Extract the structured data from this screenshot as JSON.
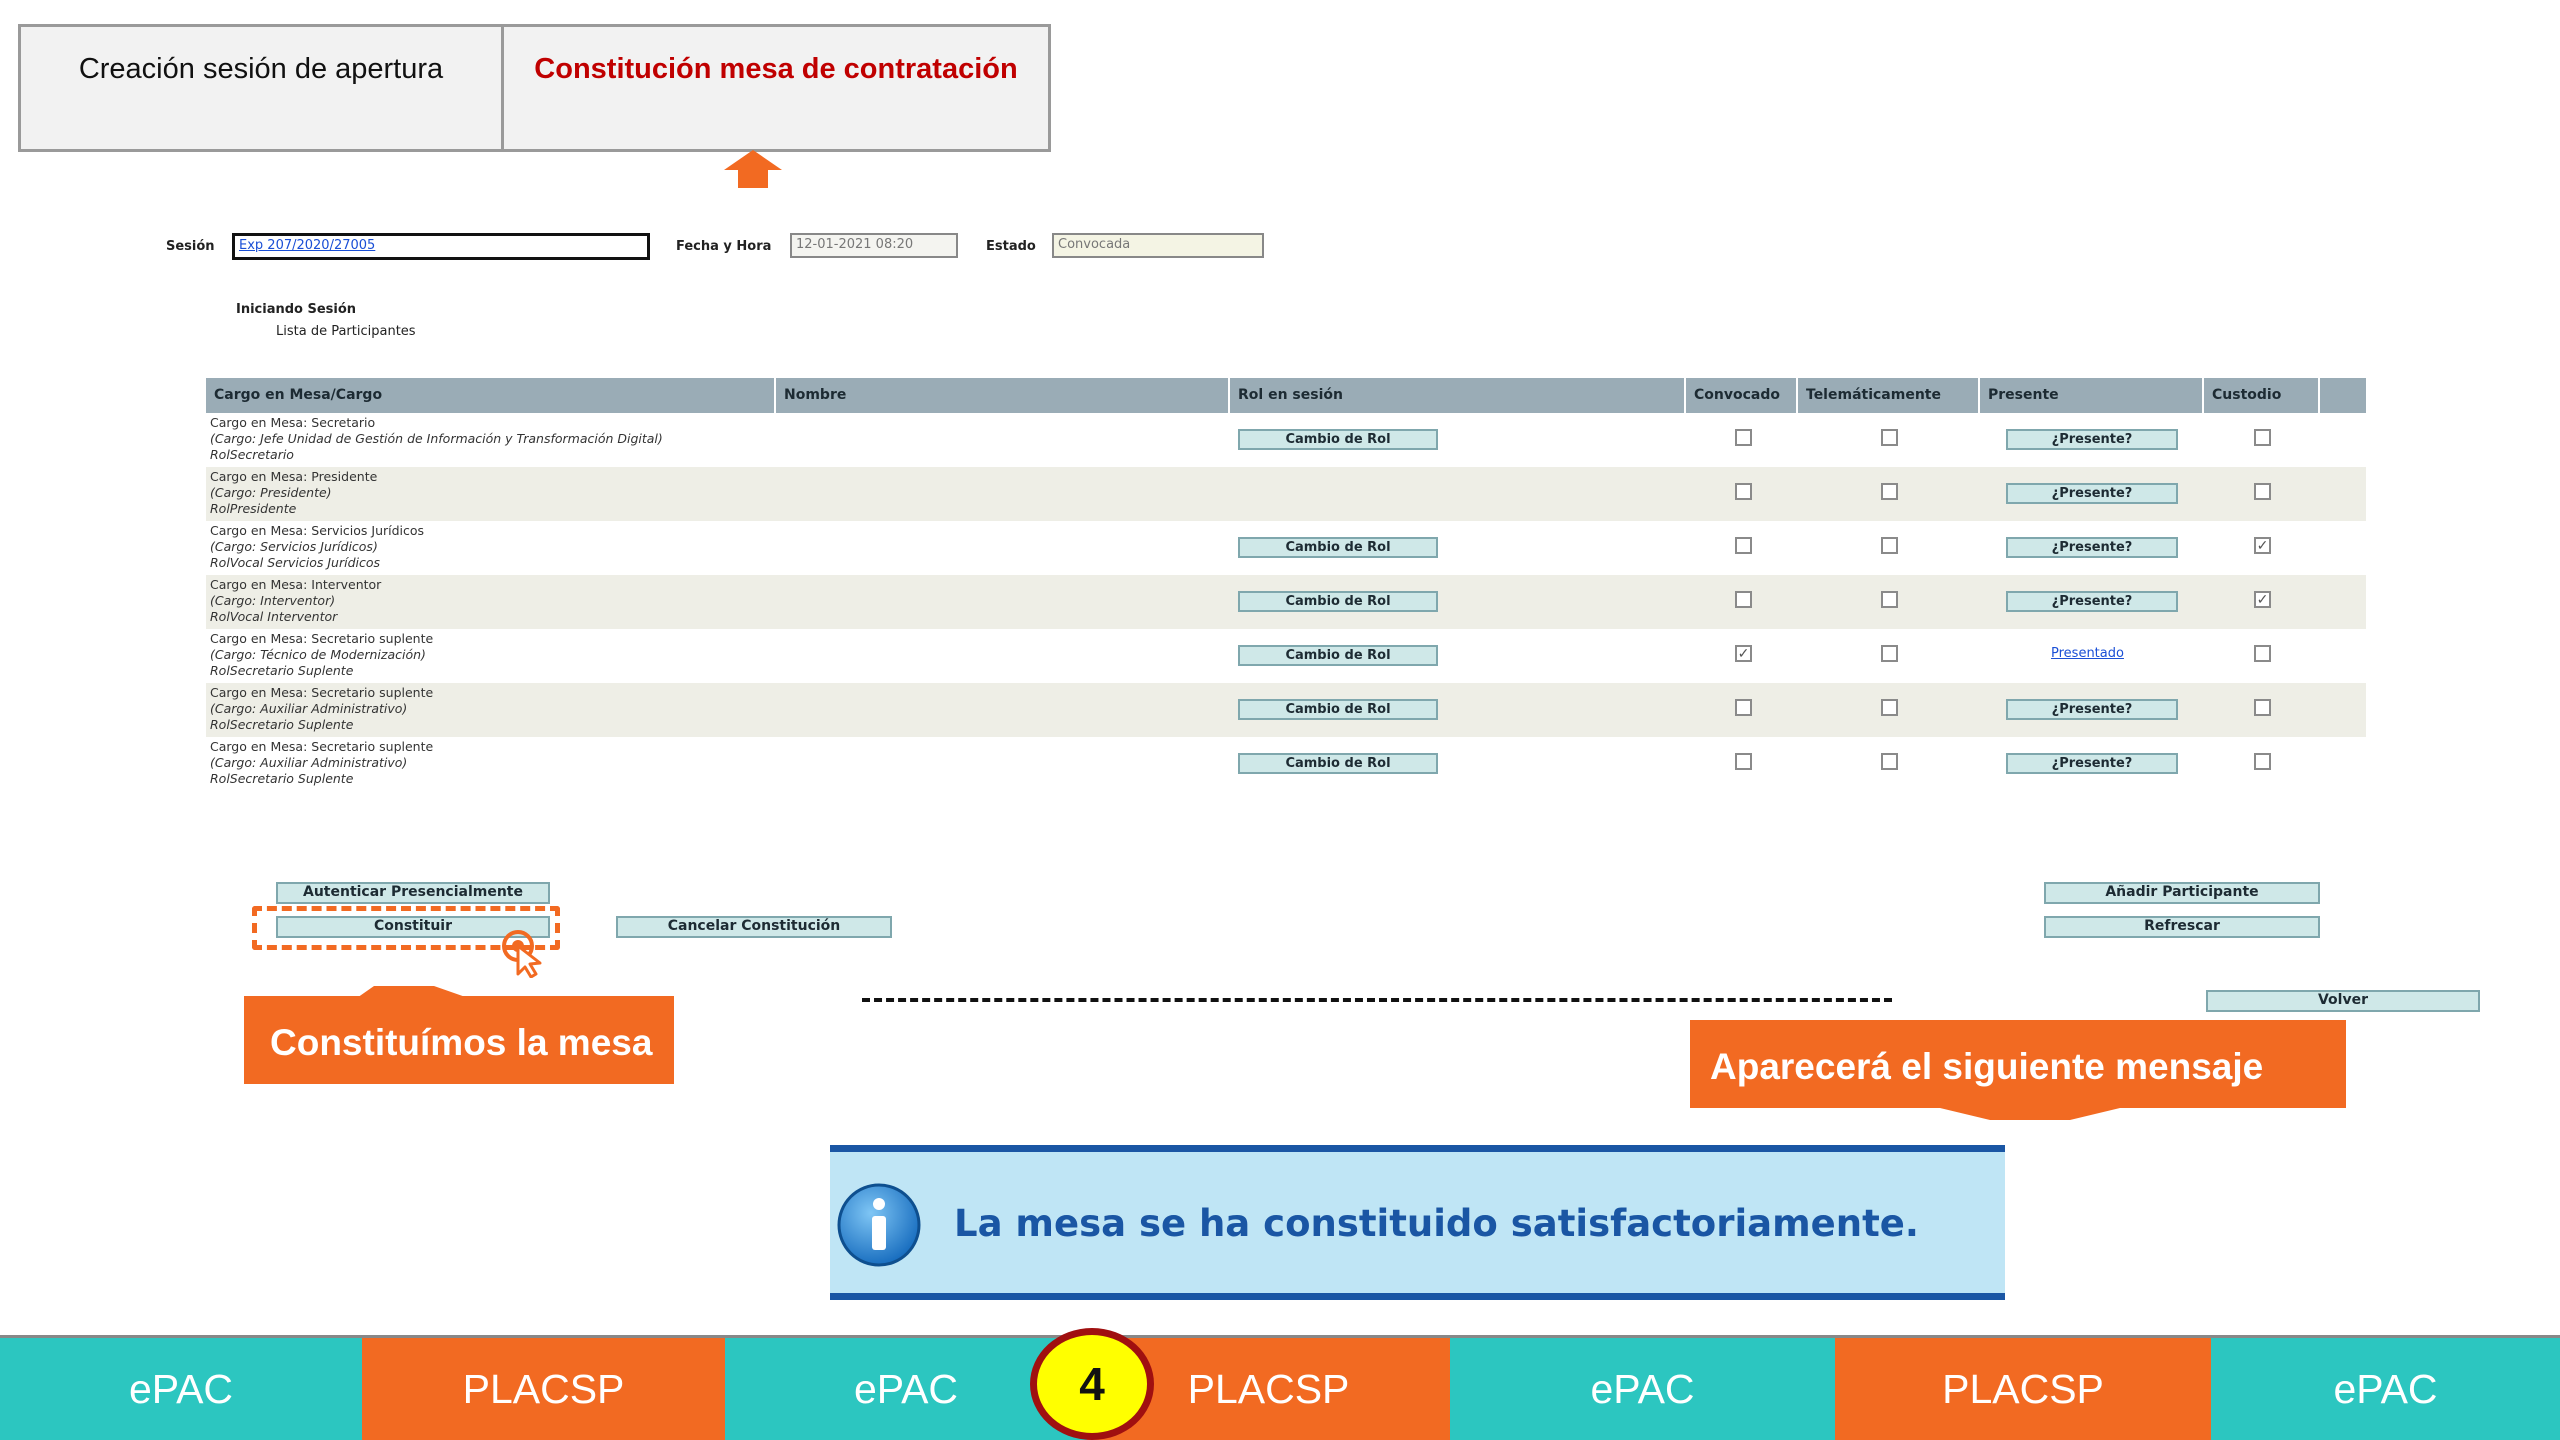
{
  "top_tabs": [
    {
      "label": "Creación sesión de apertura",
      "active": false
    },
    {
      "label": "Constitución mesa de contratación",
      "active": true
    }
  ],
  "form": {
    "session_label": "Sesión",
    "session_value": "Exp 207/2020/27005",
    "date_label": "Fecha y Hora",
    "date_value": "12-01-2021 08:20",
    "status_label": "Estado",
    "status_value": "Convocada"
  },
  "section": {
    "title": "Iniciando Sesión",
    "subtitle": "Lista de Participantes"
  },
  "table": {
    "headers": [
      "Cargo en Mesa/Cargo",
      "Nombre",
      "Rol en sesión",
      "Convocado",
      "Telemáticamente",
      "Presente",
      "Custodio"
    ],
    "rows": [
      {
        "line1": "Cargo en Mesa: Secretario",
        "line2": "(Cargo: Jefe Unidad de Gestión de Información y Transformación Digital)",
        "line3": "RolSecretario",
        "rol_button": "Cambio de Rol",
        "convocado": false,
        "telematicamente": false,
        "presente": "¿Presente?",
        "presente_is_link": false,
        "custodio": false
      },
      {
        "line1": "Cargo en Mesa: Presidente",
        "line2": "(Cargo: Presidente)",
        "line3": "RolPresidente",
        "rol_button": "",
        "convocado": false,
        "telematicamente": false,
        "presente": "¿Presente?",
        "presente_is_link": false,
        "custodio": false
      },
      {
        "line1": "Cargo en Mesa: Servicios Jurídicos",
        "line2": "(Cargo: Servicios Jurídicos)",
        "line3": "RolVocal Servicios Jurídicos",
        "rol_button": "Cambio de Rol",
        "convocado": false,
        "telematicamente": false,
        "presente": "¿Presente?",
        "presente_is_link": false,
        "custodio": true
      },
      {
        "line1": "Cargo en Mesa: Interventor",
        "line2": "(Cargo: Interventor)",
        "line3": "RolVocal Interventor",
        "rol_button": "Cambio de Rol",
        "convocado": false,
        "telematicamente": false,
        "presente": "¿Presente?",
        "presente_is_link": false,
        "custodio": true
      },
      {
        "line1": "Cargo en Mesa: Secretario suplente",
        "line2": "(Cargo: Técnico de Modernización)",
        "line3": "RolSecretario Suplente",
        "rol_button": "Cambio de Rol",
        "convocado": true,
        "telematicamente": false,
        "presente": "Presentado",
        "presente_is_link": true,
        "custodio": false
      },
      {
        "line1": "Cargo en Mesa: Secretario suplente",
        "line2": "(Cargo: Auxiliar Administrativo)",
        "line3": "RolSecretario Suplente",
        "rol_button": "Cambio de Rol",
        "convocado": false,
        "telematicamente": false,
        "presente": "¿Presente?",
        "presente_is_link": false,
        "custodio": false
      },
      {
        "line1": "Cargo en Mesa: Secretario suplente",
        "line2": "(Cargo: Auxiliar Administrativo)",
        "line3": "RolSecretario Suplente",
        "rol_button": "Cambio de Rol",
        "convocado": false,
        "telematicamente": false,
        "presente": "¿Presente?",
        "presente_is_link": false,
        "custodio": false
      }
    ]
  },
  "actions": {
    "autenticar": "Autenticar Presencialmente",
    "constituir": "Constituir",
    "cancelar": "Cancelar Constitución",
    "anadir": "Añadir Participante",
    "refrescar": "Refrescar",
    "volver": "Volver"
  },
  "callouts": {
    "left": "Constituímos la mesa",
    "right": "Aparecerá el siguiente mensaje"
  },
  "message": {
    "text": "La mesa se ha constituido satisfactoriamente.",
    "icon": "info-icon"
  },
  "bottom_band": {
    "step_number": "4",
    "segments": [
      "ePAC",
      "PLACSP",
      "ePAC",
      "PLACSP",
      "ePAC",
      "PLACSP",
      "ePAC"
    ]
  },
  "colors": {
    "accent_orange": "#f26a22",
    "teal": "#2cc6c0",
    "tab_active_text": "#c00000",
    "table_header": "#9aacb6",
    "message_bg": "#bfe5f5",
    "message_border": "#1a56a4",
    "step_badge_fill": "#ffff00",
    "step_badge_border": "#a01010"
  }
}
